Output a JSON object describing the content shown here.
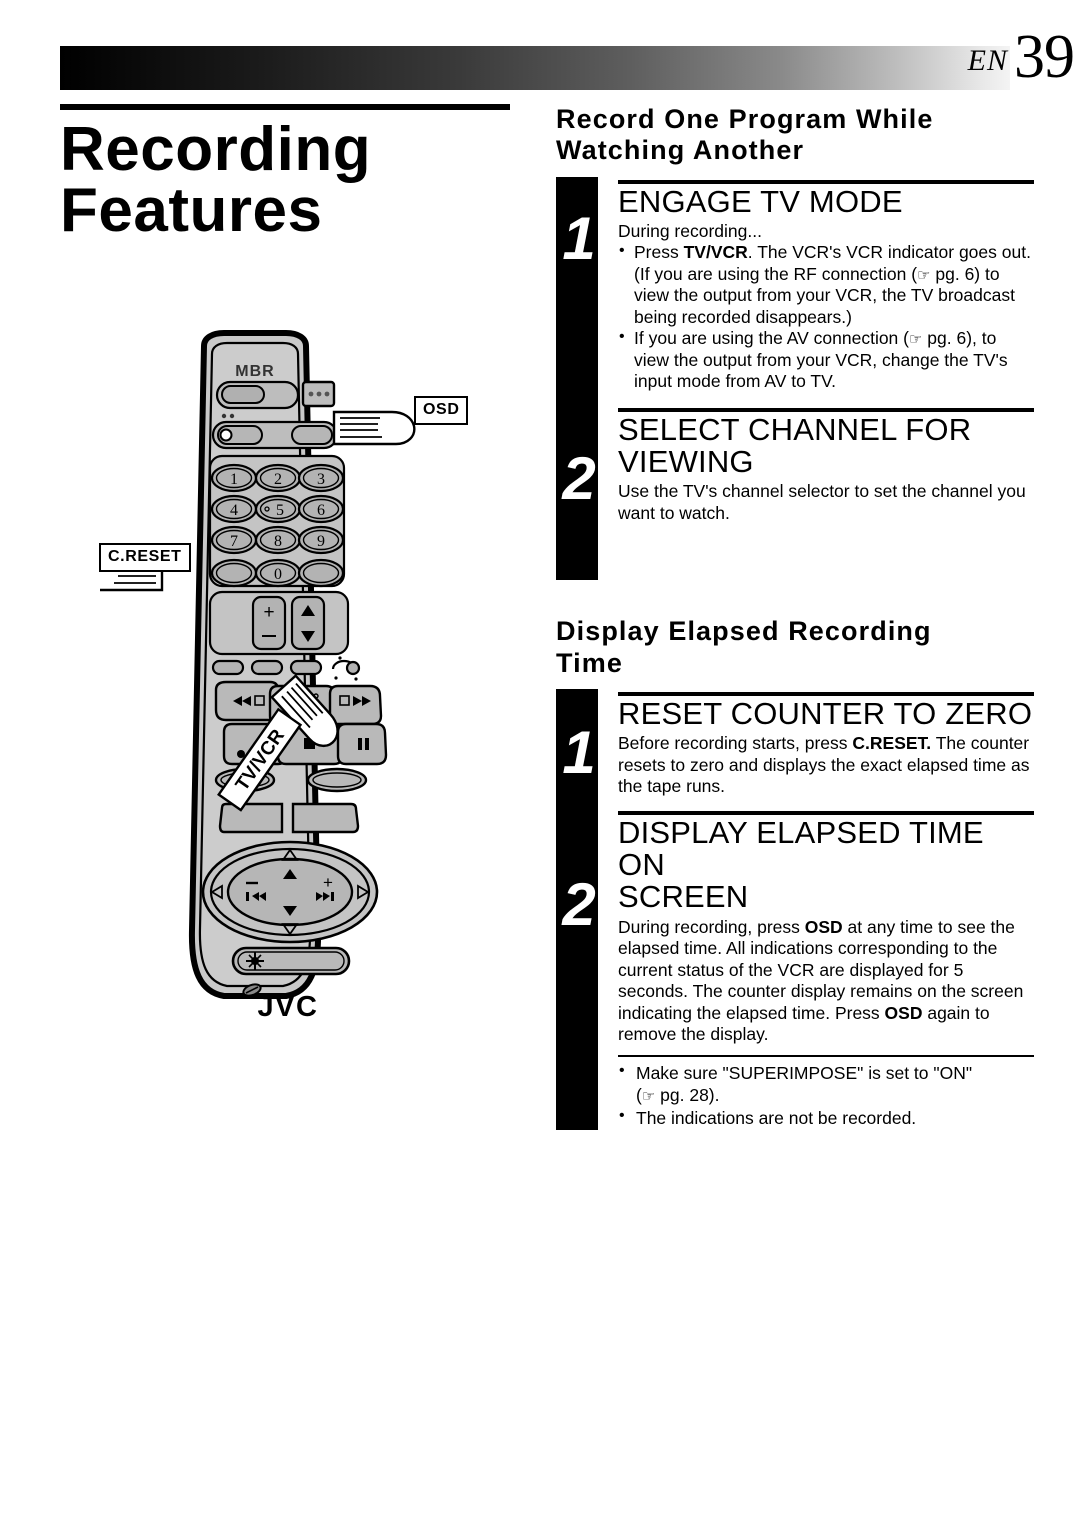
{
  "header": {
    "lang_code": "EN",
    "page_number": "39"
  },
  "chapter": {
    "title_line1": "Recording",
    "title_line2": "Features"
  },
  "sections": [
    {
      "heading_line1": "Record One Program While",
      "heading_line2": "Watching Another",
      "steps": [
        {
          "number": "1",
          "title_line1": "ENGAGE TV MODE",
          "title_line2": "",
          "intro": "During recording...",
          "bullets": [
            "Press TV/VCR. The VCR's VCR indicator goes out. (If you are using the RF connection (☞ pg. 6) to view the output from your VCR, the TV broadcast being recorded disappears.)",
            "If you are using the AV connection (☞ pg. 6), to view the output from your VCR, change the TV's input mode from AV to TV."
          ]
        },
        {
          "number": "2",
          "title_line1": "SELECT CHANNEL FOR",
          "title_line2": "VIEWING",
          "intro": "Use the TV's channel selector to set the channel you want to watch.",
          "bullets": []
        }
      ]
    },
    {
      "heading_line1": "Display Elapsed Recording",
      "heading_line2": "Time",
      "steps": [
        {
          "number": "1",
          "title_line1": "RESET COUNTER TO ZERO",
          "title_line2": "",
          "intro": "Before recording starts, press C.RESET. The counter resets to zero and displays the exact elapsed time as the tape runs.",
          "bullets": []
        },
        {
          "number": "2",
          "title_line1": "DISPLAY ELAPSED TIME ON",
          "title_line2": "SCREEN",
          "intro": "During recording, press OSD at any time to see the elapsed time. All indications corresponding to the current status of the VCR are displayed for 5 seconds. The counter display remains on the screen indicating the elapsed time. Press OSD again to remove the display.",
          "bullets": []
        }
      ],
      "notes": [
        "Make sure \"SUPERIMPOSE\" is set to \"ON\" (☞ pg. 28).",
        "The indications are not be recorded."
      ]
    }
  ],
  "illustration": {
    "device": "remote-control",
    "brand_logo": "JVC",
    "top_logo": "MBR",
    "callouts": [
      {
        "label": "OSD",
        "points_to": "osd-button"
      },
      {
        "label": "C.RESET",
        "points_to": "c-reset-button"
      },
      {
        "label": "TV/VCR",
        "points_to": "tv-vcr-button"
      }
    ],
    "keypad": [
      "1",
      "2",
      "3",
      "4",
      "5",
      "6",
      "7",
      "8",
      "9",
      "0"
    ],
    "rocker_left": {
      "plus": "+",
      "minus": "−"
    },
    "rocker_right": {
      "up": "▲",
      "down": "▼"
    }
  },
  "colors": {
    "ink": "#000000",
    "paper": "#ffffff",
    "remote_body": "#c9c9c9",
    "remote_panel": "#bdbdbd",
    "button_face": "#b3b3b3"
  }
}
